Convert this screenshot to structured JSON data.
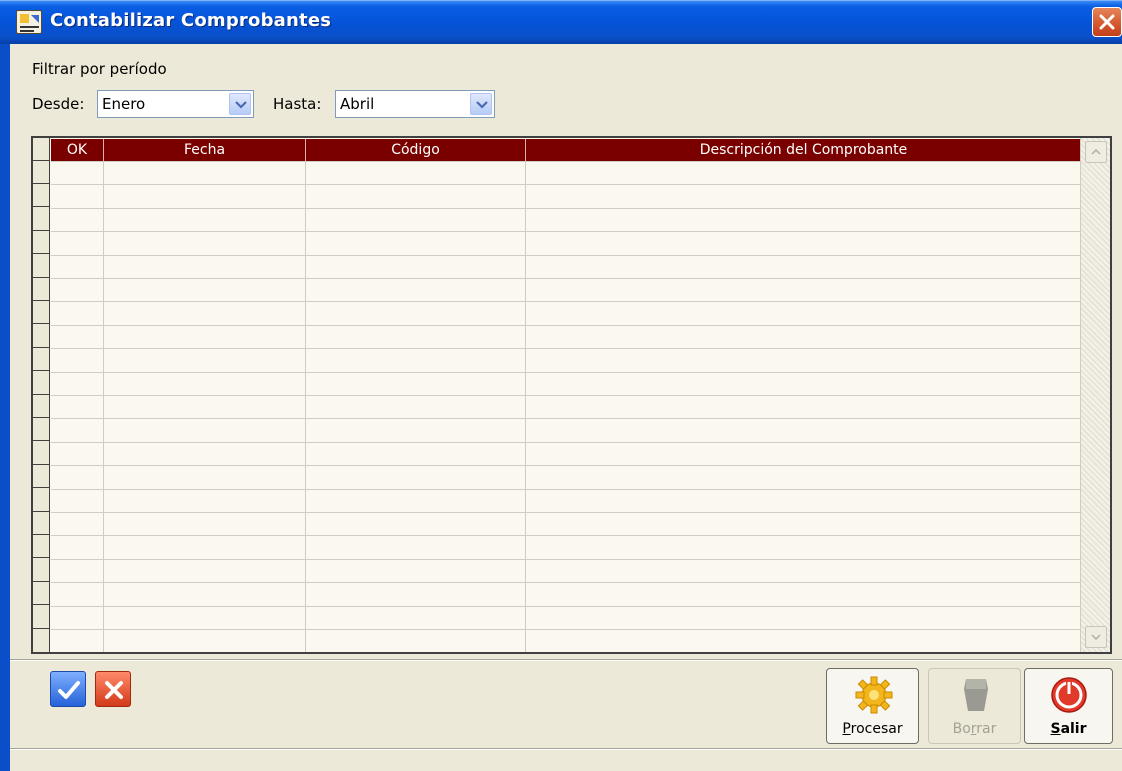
{
  "window": {
    "title": "Contabilizar Comprobantes"
  },
  "filter": {
    "title": "Filtrar por período",
    "desde_label": "Desde:",
    "desde_value": "Enero",
    "hasta_label": "Hasta:",
    "hasta_value": "Abril"
  },
  "grid": {
    "columns": [
      "OK",
      "Fecha",
      "Código",
      "Descripción del Comprobante"
    ],
    "rows": []
  },
  "buttons": {
    "procesar": "Procesar",
    "borrar": "Borrar",
    "salir": "Salir"
  },
  "icons": {
    "ok": "checkmark-icon",
    "cancel": "x-icon",
    "procesar": "gear-icon",
    "borrar": "eraser-icon",
    "salir": "power-icon"
  },
  "colors": {
    "title_bar": "#0553d8",
    "grid_header": "#7a0000",
    "grid_background": "#fbf8ef",
    "window_background": "#ece9d8"
  }
}
